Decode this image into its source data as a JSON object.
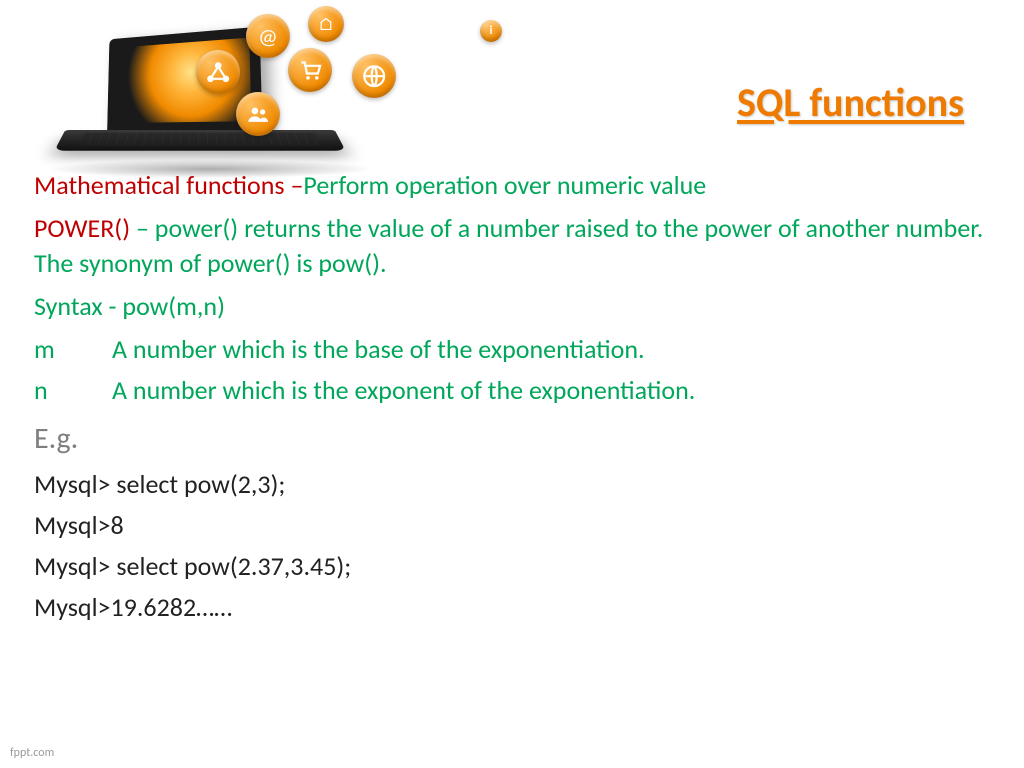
{
  "title": " SQL functions",
  "graphic_icons": {
    "at": "@",
    "home": "⌂",
    "info": "i",
    "network": "share",
    "cart": "cart",
    "globe": "globe",
    "people": "people"
  },
  "section": {
    "label": "Mathematical functions –",
    "desc": "Perform operation over numeric value"
  },
  "func": {
    "name": "POWER()",
    "sep": " – ",
    "desc": "power() returns the value of a number raised to the power of another number. The synonym of power() is pow()."
  },
  "syntax": {
    "label": "Syntax -  ",
    "value": "pow(m,n)"
  },
  "params": [
    {
      "name": "m",
      "desc": "A number which is the base of the exponentiation."
    },
    {
      "name": "n",
      "desc": "A number which is the exponent of the exponentiation."
    }
  ],
  "example_label": "E.g.",
  "example_lines": [
    "Mysql> select pow(2,3);",
    "Mysql>8",
    "Mysql> select pow(2.37,3.45);",
    "Mysql>19.6282……"
  ],
  "footer": "fppt.com"
}
